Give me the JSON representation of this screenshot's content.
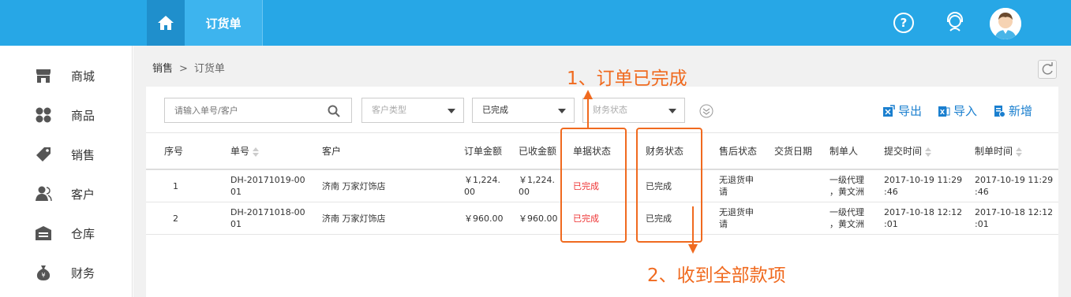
{
  "header": {
    "active_tab": "订货单",
    "colors": {
      "bar": "#27a7e6",
      "home": "#1f8fcc",
      "accent": "#f06a1f"
    }
  },
  "sidebar": {
    "items": [
      {
        "label": "商城",
        "icon": "store-icon"
      },
      {
        "label": "商品",
        "icon": "grid-icon"
      },
      {
        "label": "销售",
        "icon": "tag-icon"
      },
      {
        "label": "客户",
        "icon": "user-icon"
      },
      {
        "label": "仓库",
        "icon": "warehouse-icon"
      },
      {
        "label": "财务",
        "icon": "money-bag-icon"
      }
    ]
  },
  "breadcrumb": {
    "parent": "销售",
    "separator": ">",
    "current": "订货单"
  },
  "filters": {
    "search_placeholder": "请输入单号/客户",
    "customer_type_placeholder": "客户类型",
    "order_status_value": "已完成",
    "finance_status_placeholder": "财务状态"
  },
  "actions": {
    "export": "导出",
    "import": "导入",
    "add": "新增"
  },
  "table": {
    "headers": {
      "index": "序号",
      "order_no": "单号",
      "customer": "客户",
      "amount": "订单金额",
      "received": "已收金额",
      "doc_status": "单据状态",
      "finance_status": "财务状态",
      "after_sale": "售后状态",
      "delivery_date": "交货日期",
      "creator": "制单人",
      "submit_time": "提交时间",
      "create_time": "制单时间"
    },
    "rows": [
      {
        "index": "1",
        "order_no_1": "DH-20171019-00",
        "order_no_2": "01",
        "customer": "济南 万家灯饰店",
        "amount_1": "￥1,224.",
        "amount_2": "00",
        "received_1": "￥1,224.",
        "received_2": "00",
        "doc_status": "已完成",
        "finance_status": "已完成",
        "after_sale_1": "无退货申",
        "after_sale_2": "请",
        "delivery_date": "",
        "creator_1": "一级代理",
        "creator_2": "，黄文洲",
        "submit_1": "2017-10-19 11:29",
        "submit_2": ":46",
        "create_1": "2017-10-19 11:29",
        "create_2": ":46"
      },
      {
        "index": "2",
        "order_no_1": "DH-20171018-00",
        "order_no_2": "01",
        "customer": "济南 万家灯饰店",
        "amount": "￥960.00",
        "received": "￥960.00",
        "doc_status": "已完成",
        "finance_status": "已完成",
        "after_sale_1": "无退货申",
        "after_sale_2": "请",
        "delivery_date": "",
        "creator_1": "一级代理",
        "creator_2": "，黄文洲",
        "submit_1": "2017-10-18 12:12",
        "submit_2": ":01",
        "create_1": "2017-10-18 12:12",
        "create_2": ":01"
      }
    ]
  },
  "annotations": {
    "note1": "1、订单已完成",
    "note2": "2、收到全部款项"
  }
}
